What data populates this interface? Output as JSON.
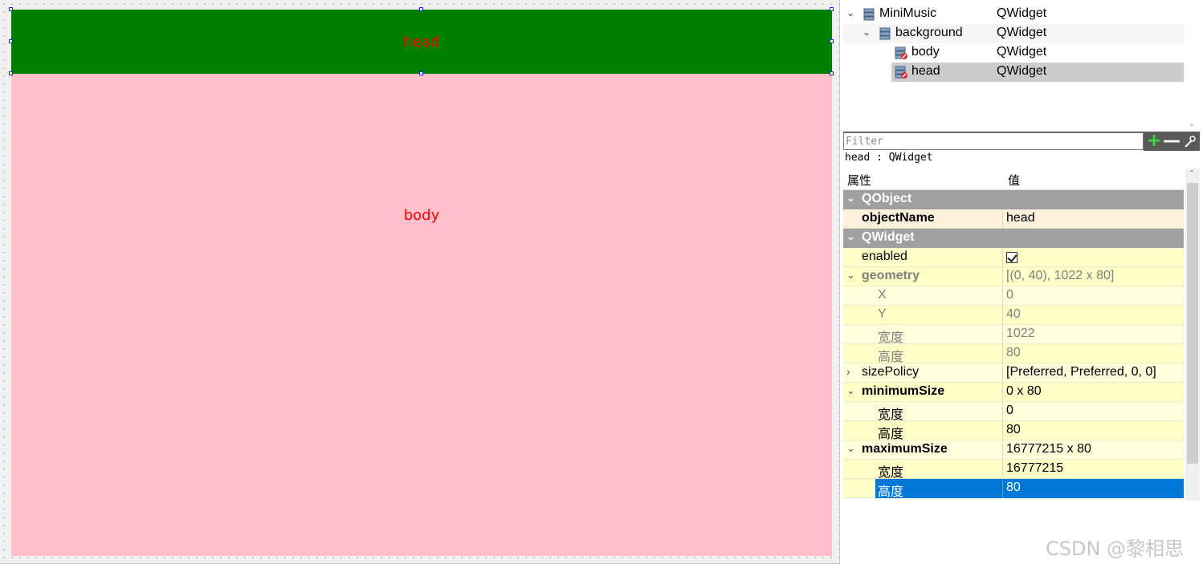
{
  "canvas": {
    "head_widget": {
      "label": "head",
      "bg": "#008000",
      "text_color": "#ff0000"
    },
    "body_widget": {
      "label": "body",
      "bg": "#ffc0cb",
      "text_color": "#ff0000"
    }
  },
  "object_inspector": {
    "items": [
      {
        "name": "MiniMusic",
        "class": "QWidget"
      },
      {
        "name": "background",
        "class": "QWidget"
      },
      {
        "name": "body",
        "class": "QWidget"
      },
      {
        "name": "head",
        "class": "QWidget"
      }
    ]
  },
  "property_editor": {
    "filter_placeholder": "Filter",
    "object_label": "head : QWidget",
    "header": {
      "property": "属性",
      "value": "值"
    },
    "rows": [
      {
        "name": "QObject",
        "value": ""
      },
      {
        "name": "objectName",
        "value": "head"
      },
      {
        "name": "QWidget",
        "value": ""
      },
      {
        "name": "enabled",
        "value": ""
      },
      {
        "name": "geometry",
        "value": "[(0, 40), 1022 x 80]"
      },
      {
        "name": "X",
        "value": "0"
      },
      {
        "name": "Y",
        "value": "40"
      },
      {
        "name": "宽度",
        "value": "1022"
      },
      {
        "name": "高度",
        "value": "80"
      },
      {
        "name": "sizePolicy",
        "value": "[Preferred, Preferred, 0, 0]"
      },
      {
        "name": "minimumSize",
        "value": "0 x 80"
      },
      {
        "name": "宽度",
        "value": "0"
      },
      {
        "name": "高度",
        "value": "80"
      },
      {
        "name": "maximumSize",
        "value": "16777215 x 80"
      },
      {
        "name": "宽度",
        "value": "16777215"
      },
      {
        "name": "高度",
        "value": "80"
      }
    ],
    "enabled_checked": true
  },
  "watermark": "CSDN @黎相思"
}
